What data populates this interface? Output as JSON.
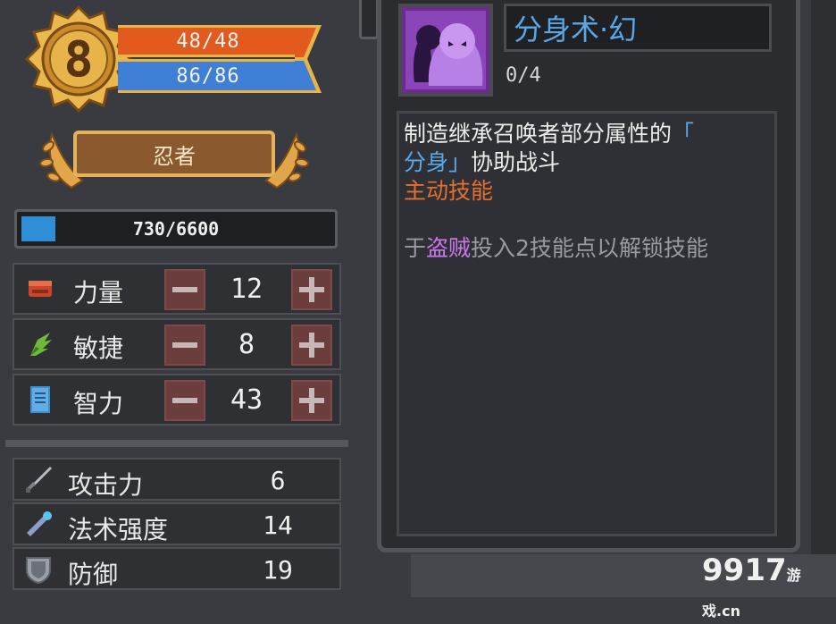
{
  "level": "8",
  "hp": "48/48",
  "mp": "86/86",
  "character_class": "忍者",
  "xp": "730/6600",
  "xp_progress": 0.11,
  "attributes": [
    {
      "label": "力量",
      "value": "12",
      "icon": "fist-icon"
    },
    {
      "label": "敏捷",
      "value": "8",
      "icon": "wing-icon"
    },
    {
      "label": "智力",
      "value": "43",
      "icon": "book-icon"
    }
  ],
  "combat_stats": [
    {
      "label": "攻击力",
      "value": "6",
      "icon": "sword-icon"
    },
    {
      "label": "法术强度",
      "value": "14",
      "icon": "wand-icon"
    },
    {
      "label": "防御",
      "value": "19",
      "icon": "shield-icon"
    }
  ],
  "skill": {
    "name": "分身术·幻",
    "level": "0/4",
    "desc_line1": "制造继承召唤者部分属性的",
    "desc_bracket_open": "「",
    "desc_clone": "分身」",
    "desc_line2_rest": "协助战斗",
    "type": "主动技能",
    "unlock_prefix": "于",
    "unlock_class": "盗贼",
    "unlock_suffix": "投入2技能点以解锁技能"
  },
  "watermark": {
    "main": "9917",
    "sub": "游戏",
    "domain": ".cn"
  },
  "colors": {
    "hp_bar": "#e35a1e",
    "mp_bar": "#3f7fd6",
    "xp_bar": "#2f8ed6",
    "skill_title": "#5aa7e6",
    "skill_type": "#e56f2c",
    "unlock_class": "#c878e8",
    "gold_frame": "#e7b44a"
  }
}
